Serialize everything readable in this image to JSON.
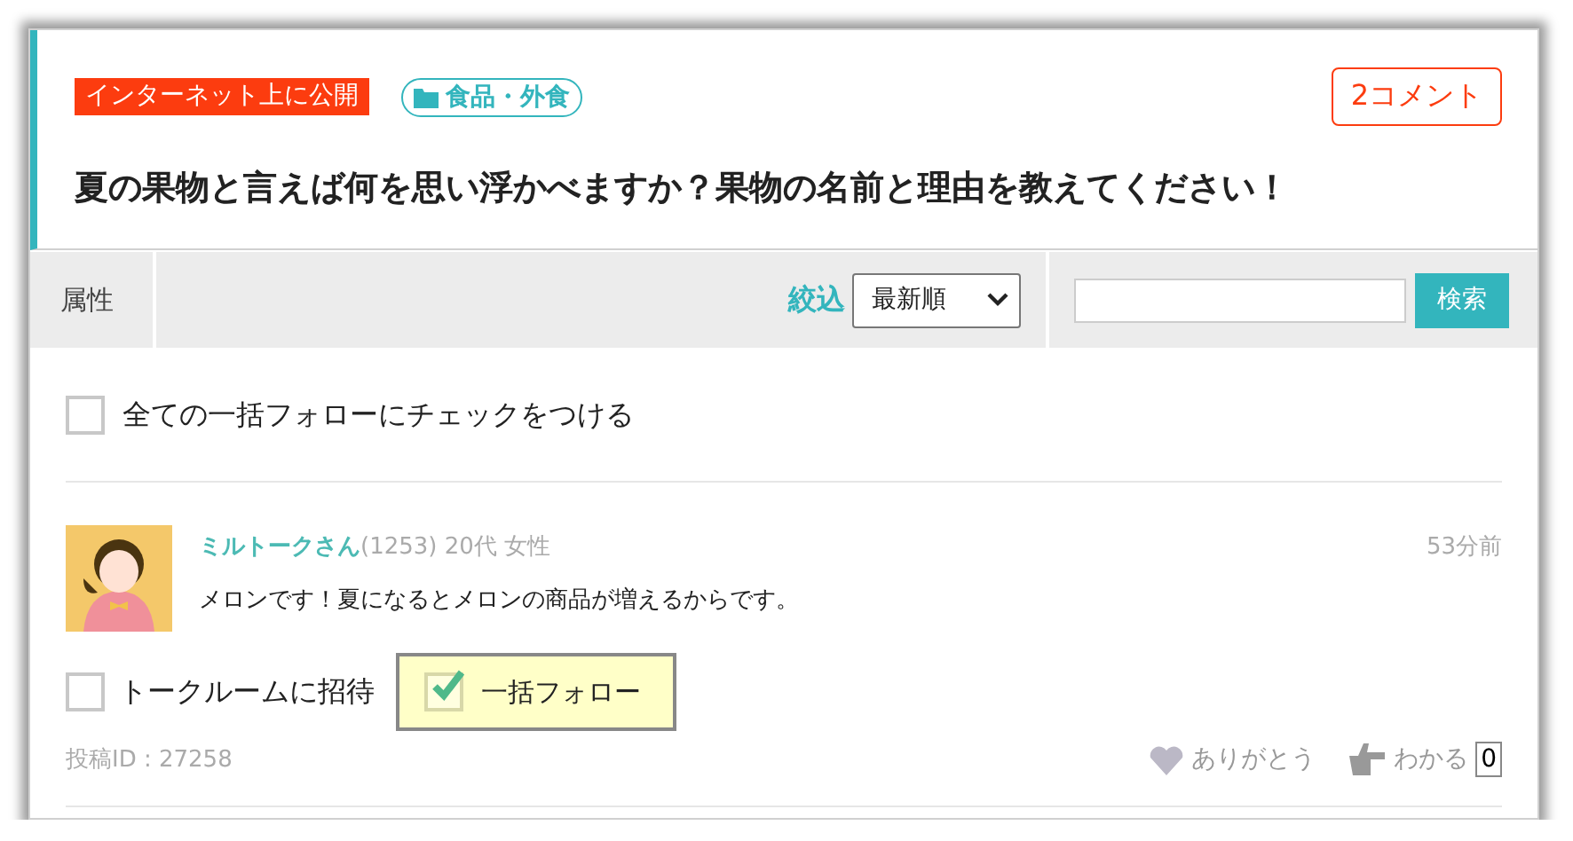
{
  "visibility": "インターネット上に公開",
  "category": "食品・外食",
  "comment_count": "2コメント",
  "question": "夏の果物と言えば何を思い浮かべますか？果物の名前と理由を教えてください！",
  "toolbar": {
    "attribute_label": "属性",
    "filter_label": "絞込",
    "sort": {
      "value": "最新順"
    },
    "search": {
      "button": "検索"
    }
  },
  "follow_all": {
    "label": "全ての一括フォローにチェックをつける",
    "checked": false
  },
  "posts": [
    {
      "user": "ミルトークさん",
      "count": "(1253)",
      "age": "20代",
      "gender": "女性",
      "time": "53分前",
      "body": "メロンです！夏になるとメロンの商品が増えるからです。",
      "invite": {
        "label": "トークルームに招待",
        "checked": false
      },
      "follow": {
        "label": "一括フォロー",
        "checked": true
      },
      "post_id": "投稿ID : 27258",
      "thanks": "ありがとう",
      "agree": "わかる",
      "agree_count": "0"
    }
  ]
}
